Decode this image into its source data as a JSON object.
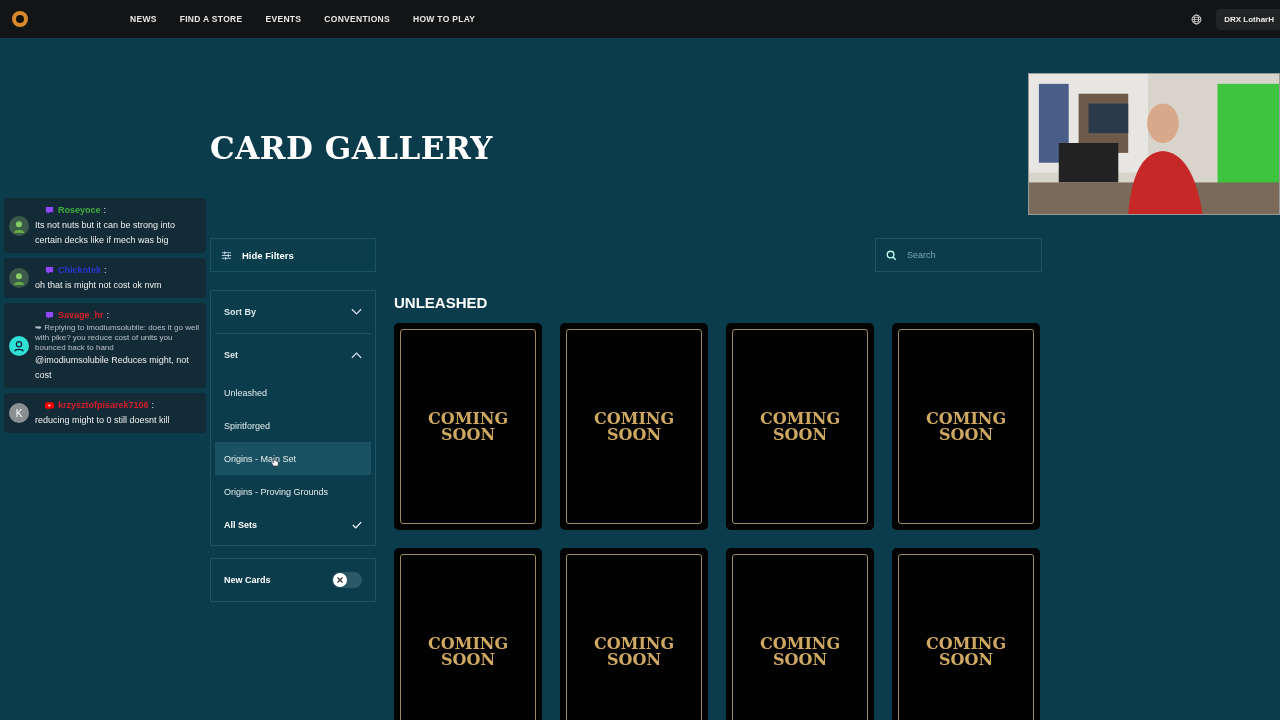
{
  "nav": {
    "links": [
      "NEWS",
      "FIND A STORE",
      "EVENTS",
      "CONVENTIONS",
      "HOW TO PLAY"
    ],
    "account": "DRX LotharH"
  },
  "page_title": "CARD GALLERY",
  "filters": {
    "toggle_label": "Hide Filters",
    "sort_by": {
      "label": "Sort By",
      "expanded": false
    },
    "set": {
      "label": "Set",
      "expanded": true,
      "options": [
        {
          "label": "Unleashed",
          "selected": false,
          "hovered": false
        },
        {
          "label": "Spiritforged",
          "selected": false,
          "hovered": false
        },
        {
          "label": "Origins - Main Set",
          "selected": false,
          "hovered": true
        },
        {
          "label": "Origins - Proving Grounds",
          "selected": false,
          "hovered": false
        },
        {
          "label": "All Sets",
          "selected": true,
          "hovered": false
        }
      ]
    },
    "new_cards": {
      "label": "New Cards",
      "on": false
    }
  },
  "search": {
    "placeholder": "Search"
  },
  "section_title": "UNLEASHED",
  "cards": [
    {
      "text": "COMING SOON"
    },
    {
      "text": "COMING SOON"
    },
    {
      "text": "COMING SOON"
    },
    {
      "text": "COMING SOON"
    },
    {
      "text": "COMING SOON"
    },
    {
      "text": "COMING SOON"
    },
    {
      "text": "COMING SOON"
    },
    {
      "text": "COMING SOON"
    }
  ],
  "chat": [
    {
      "badge": {
        "kind": "twitch"
      },
      "color": "#3fae3f",
      "user": "Roseyoce",
      "separator": ":",
      "message": "Its not nuts but it can be strong into certain decks like if mech was big"
    },
    {
      "badge": {
        "kind": "twitch"
      },
      "color": "#2a36d8",
      "user": "Chickotek",
      "separator": ":",
      "message": "oh that is might not cost ok nvm"
    },
    {
      "badge": {
        "kind": "twitch"
      },
      "avatar": {
        "kind": "person"
      },
      "color": "#d81e2a",
      "user": "Savage_hr",
      "separator": ":",
      "reply": "➥ Replying to imodiumsolubile: does it go well with pike? you reduce cost of units you bounced back to hand",
      "message": "@imodiumsolubile Reduces might, not cost"
    },
    {
      "badge": {
        "kind": "youtube"
      },
      "avatar": {
        "kind": "letter",
        "letter": "K"
      },
      "color": "#d81e2a",
      "user": "krzysztofpisarek7106",
      "separator": ":",
      "message": "reducing might to 0 still doesnt kill"
    }
  ]
}
